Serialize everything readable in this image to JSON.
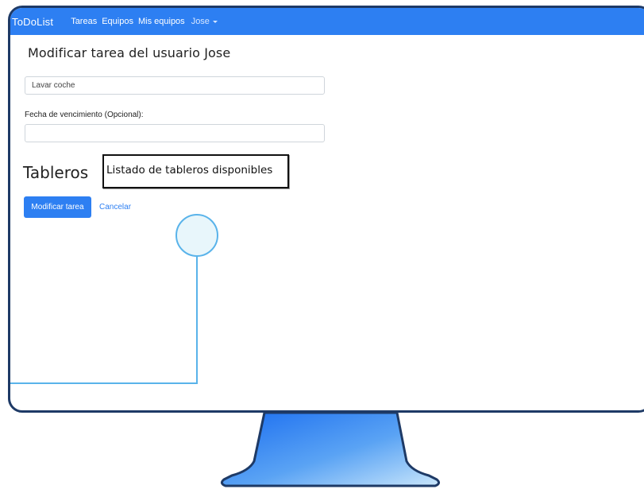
{
  "navbar": {
    "brand": "ToDoList",
    "items": [
      {
        "label": "Tareas"
      },
      {
        "label": "Equipos"
      },
      {
        "label": "Mis equipos"
      }
    ],
    "user": "Jose"
  },
  "main": {
    "title": "Modificar tarea del usuario Jose",
    "task_input": {
      "value": "Lavar coche"
    },
    "due_date_label": "Fecha de vencimiento (Opcional):",
    "due_date_input": {
      "value": ""
    },
    "boards_heading": "Tableros",
    "boards_box_text": "Listado de tableros disponibles",
    "submit_label": "Modificar tarea",
    "cancel_label": "Cancelar"
  },
  "colors": {
    "navbar": "#2d7ff2",
    "primary_button": "#2d7ff2",
    "monitor_frame": "#1e3a66",
    "callout": "#59b3ea"
  }
}
